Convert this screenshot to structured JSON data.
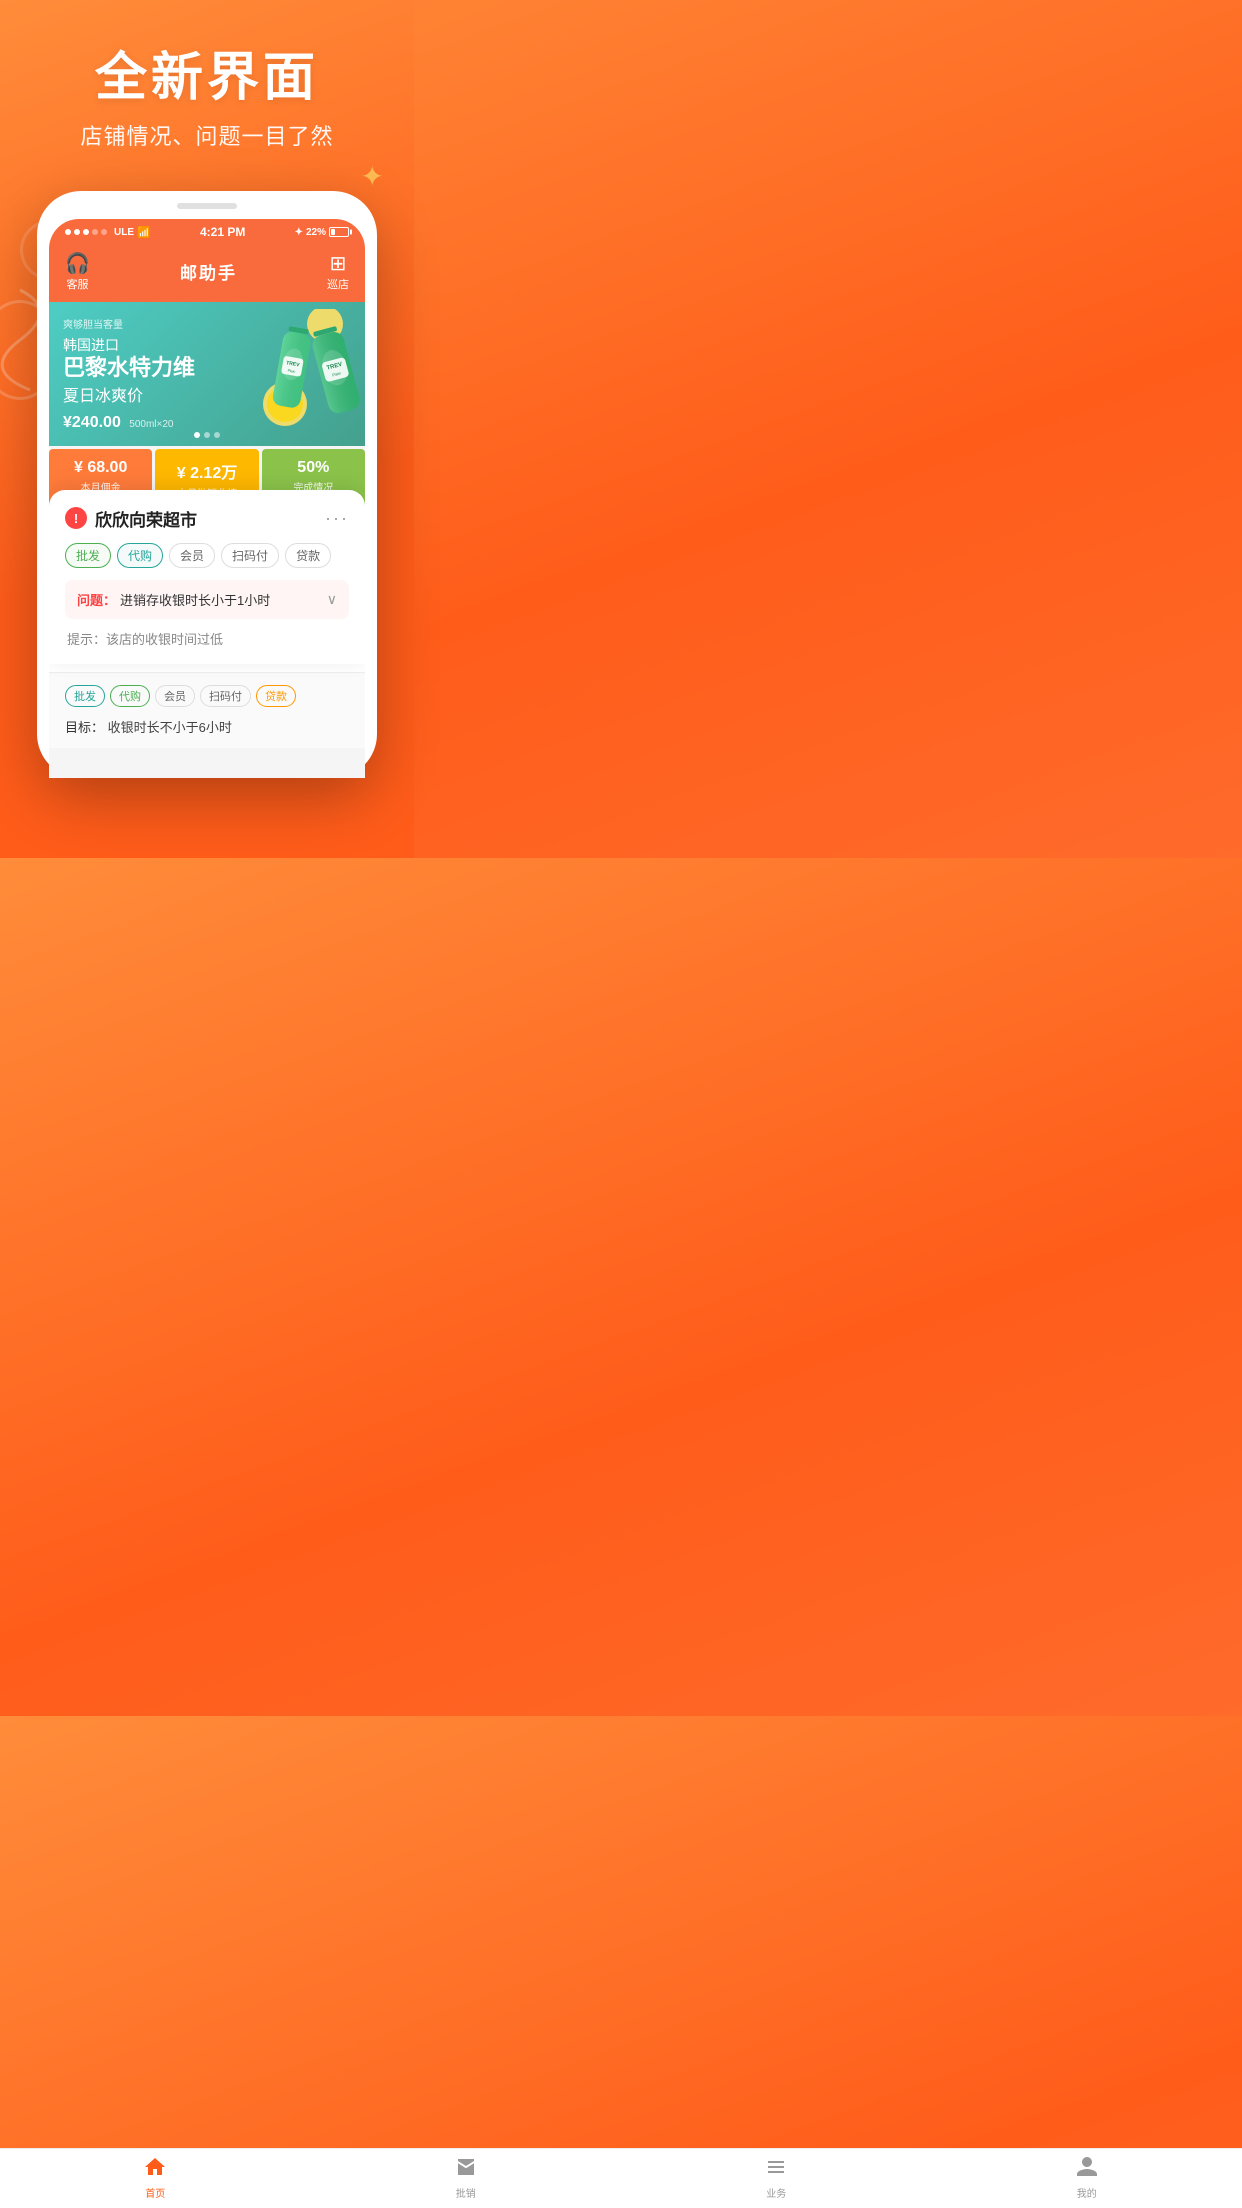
{
  "header": {
    "main_title": "全新界面",
    "sub_title": "店铺情况、问题一目了然"
  },
  "status_bar": {
    "carrier": "ULE",
    "time": "4:21 PM",
    "battery": "22%"
  },
  "app_header": {
    "left_icon": "headset",
    "left_label": "客服",
    "title": "邮助手",
    "right_icon": "scan",
    "right_label": "巡店"
  },
  "banner": {
    "tag": "爽够胆当客量",
    "line1": "韩国进口",
    "line2": "巴黎水特力维",
    "line3": "夏日冰爽价",
    "price": "¥240.00",
    "price_unit": "500ml×20"
  },
  "stats": [
    {
      "value": "¥ 68.00",
      "label": "本月佣金",
      "type": "orange"
    },
    {
      "value": "¥ 2.12万",
      "label": "本月批销业绩",
      "type": "yellow"
    },
    {
      "value": "50%",
      "label": "完成情况",
      "type": "green"
    }
  ],
  "card": {
    "store_name": "欣欣向荣超市",
    "more_label": "···",
    "tags": [
      {
        "label": "批发",
        "type": "green"
      },
      {
        "label": "代购",
        "type": "teal"
      },
      {
        "label": "会员",
        "type": "default"
      },
      {
        "label": "扫码付",
        "type": "default"
      },
      {
        "label": "贷款",
        "type": "default"
      }
    ],
    "problem_label": "问题：",
    "problem_text": "进销存收银时长小于1小时",
    "hint_text": "提示：该店的收银时间过低"
  },
  "second_card": {
    "tags": [
      {
        "label": "批发",
        "type": "teal"
      },
      {
        "label": "代购",
        "type": "green"
      },
      {
        "label": "会员",
        "type": "default"
      },
      {
        "label": "扫码付",
        "type": "default"
      },
      {
        "label": "贷款",
        "type": "orange"
      }
    ],
    "target_label": "目标：",
    "target_text": "收银时长不小于6小时"
  },
  "bottom_nav": [
    {
      "label": "首页",
      "icon": "home",
      "active": true
    },
    {
      "label": "批销",
      "icon": "store",
      "active": false
    },
    {
      "label": "业务",
      "icon": "list",
      "active": false
    },
    {
      "label": "我的",
      "icon": "person",
      "active": false
    }
  ]
}
